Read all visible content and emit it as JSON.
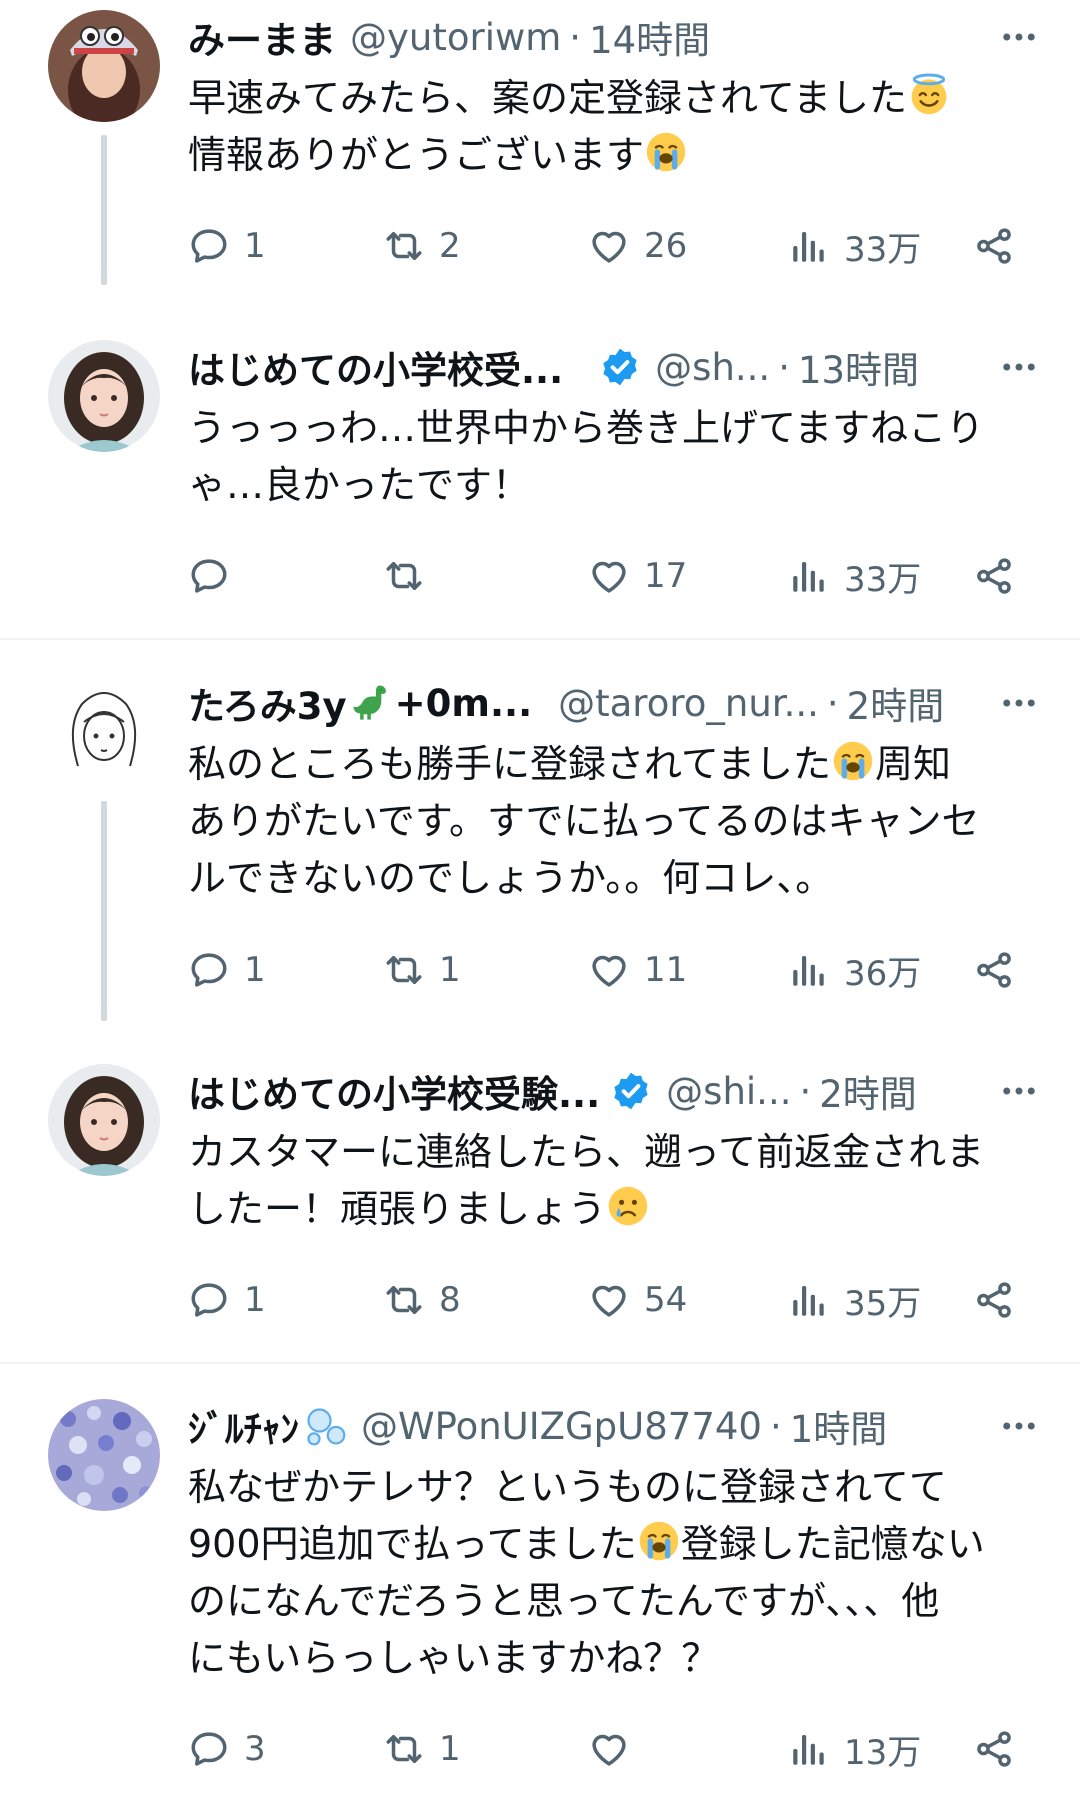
{
  "tweets": [
    {
      "name": "みーまま",
      "handle": "@yutoriwm",
      "time": "14時間",
      "lines": [
        "早速みてみたら、案の定登録されてました",
        "情報ありがとうございます"
      ],
      "replies": "1",
      "retweets": "2",
      "likes": "26",
      "views": "33万"
    },
    {
      "name": "はじめての小学校受...",
      "handle": "@sh...",
      "time": "13時間",
      "lines": [
        "うっっっわ…世界中から巻き上げてますねこり",
        "ゃ…良かったです！"
      ],
      "replies": "",
      "retweets": "",
      "likes": "17",
      "views": "33万"
    },
    {
      "name_a": "たろみ3y",
      "name_b": "+0m...",
      "handle": "@taroro_nur...",
      "time": "2時間",
      "lines": [
        "私のところも勝手に登録されてました",
        "周知",
        "ありがたいです。すでに払ってるのはキャンセ",
        "ルできないのでしょうか。。何コレ、。"
      ],
      "replies": "1",
      "retweets": "1",
      "likes": "11",
      "views": "36万"
    },
    {
      "name": "はじめての小学校受験...",
      "handle": "@shi...",
      "time": "2時間",
      "lines": [
        "カスタマーに連絡したら、遡って前返金されま",
        "したー！頑張りましょう"
      ],
      "replies": "1",
      "retweets": "8",
      "likes": "54",
      "views": "35万"
    },
    {
      "name": "ｼﾞﾙﾁｬﾝ",
      "handle": "@WPonUIZGpU87740",
      "time": "1時間",
      "lines": [
        "私なぜかテレサ？というものに登録されてて",
        "900円追加で払ってました",
        "登録した記憶ない",
        "のになんでだろうと思ってたんですが、、、他",
        "にもいらっしゃいますかね？？"
      ],
      "replies": "3",
      "retweets": "1",
      "likes": "",
      "views": "13万"
    }
  ],
  "separator": "·",
  "colors": {
    "text": "#0f1419",
    "muted": "#536471",
    "verified": "#1d9bf0",
    "thread": "#cfd9de"
  },
  "icons": [
    "more-icon",
    "reply-icon",
    "retweet-icon",
    "like-icon",
    "views-icon",
    "share-icon",
    "verified-icon"
  ]
}
